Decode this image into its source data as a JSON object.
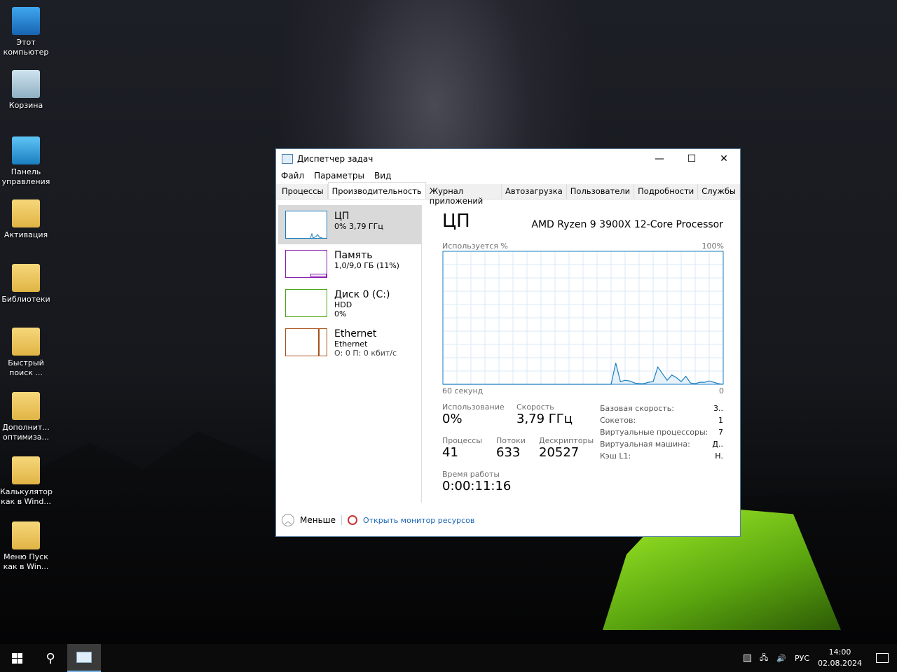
{
  "desktop": {
    "icons": [
      {
        "label": "Этот компьютер",
        "icon": "computer-icon"
      },
      {
        "label": "Корзина",
        "icon": "recycle-bin-icon"
      },
      {
        "label": "Панель управления",
        "icon": "control-panel-icon"
      },
      {
        "label": "Активация",
        "icon": "folder-icon"
      },
      {
        "label": "Библиотеки",
        "icon": "folder-icon"
      },
      {
        "label": "Быстрый поиск ...",
        "icon": "folder-icon"
      },
      {
        "label": "Дополнит... оптимиза...",
        "icon": "folder-icon"
      },
      {
        "label": "Калькулятор как в Wind...",
        "icon": "folder-icon"
      },
      {
        "label": "Меню Пуск как в Win...",
        "icon": "folder-icon"
      }
    ]
  },
  "window": {
    "title": "Диспетчер задач",
    "menu": [
      "Файл",
      "Параметры",
      "Вид"
    ],
    "tabs": [
      "Процессы",
      "Производительность",
      "Журнал приложений",
      "Автозагрузка",
      "Пользователи",
      "Подробности",
      "Службы"
    ],
    "sidebar": [
      {
        "name": "ЦП",
        "sub1": "0% 3,79 ГГц",
        "color": "#1a7ec0"
      },
      {
        "name": "Память",
        "sub1": "1,0/9,0 ГБ (11%)",
        "color": "#8b1fb0"
      },
      {
        "name": "Диск 0 (C:)",
        "sub1": "HDD",
        "sub2": "0%",
        "color": "#4da619"
      },
      {
        "name": "Ethernet",
        "sub1": "Ethernet",
        "sub2": "О: 0 П: 0 кбит/с",
        "color": "#a7521a"
      }
    ],
    "cpu": {
      "title": "ЦП",
      "processor": "AMD Ryzen 9 3900X 12-Core Processor",
      "usage_label": "Используется %",
      "max_label": "100%",
      "time_label": "60 секунд",
      "min_label": "0",
      "stats": {
        "usage_l": "Использование",
        "usage": "0%",
        "speed_l": "Скорость",
        "speed": "3,79 ГГц",
        "proc_l": "Процессы",
        "proc": "41",
        "threads_l": "Потоки",
        "threads": "633",
        "handles_l": "Дескрипторы",
        "handles": "20527",
        "uptime_l": "Время работы",
        "uptime": "0:00:11:16"
      },
      "details": [
        [
          "Базовая скорость:",
          "3.."
        ],
        [
          "Сокетов:",
          "1"
        ],
        [
          "Виртуальные процессоры:",
          "7"
        ],
        [
          "Виртуальная машина:",
          "Д.."
        ],
        [
          "Кэш L1:",
          "Н."
        ]
      ]
    },
    "footer": {
      "less": "Меньше",
      "monitor": "Открыть монитор ресурсов"
    }
  },
  "chart_data": {
    "type": "area",
    "title": "ЦП",
    "ylabel": "Используется %",
    "xlabel": "60 секунд",
    "ylim": [
      0,
      100
    ],
    "xlim": [
      60,
      0
    ],
    "values": [
      0,
      0,
      0,
      0,
      0,
      0,
      0,
      0,
      0,
      0,
      0,
      0,
      0,
      0,
      0,
      0,
      0,
      0,
      0,
      0,
      0,
      0,
      0,
      0,
      0,
      0,
      0,
      0,
      0,
      0,
      0,
      0,
      0,
      0,
      0,
      0,
      0,
      16,
      2,
      3,
      2.5,
      1,
      0.5,
      0.5,
      1.5,
      2,
      13,
      8,
      3,
      7,
      5,
      2,
      6,
      1,
      0.5,
      1.5,
      1.5,
      2.5,
      1.5,
      0.5,
      0
    ]
  },
  "taskbar": {
    "lang": "РУС",
    "time": "14:00",
    "date": "02.08.2024"
  }
}
